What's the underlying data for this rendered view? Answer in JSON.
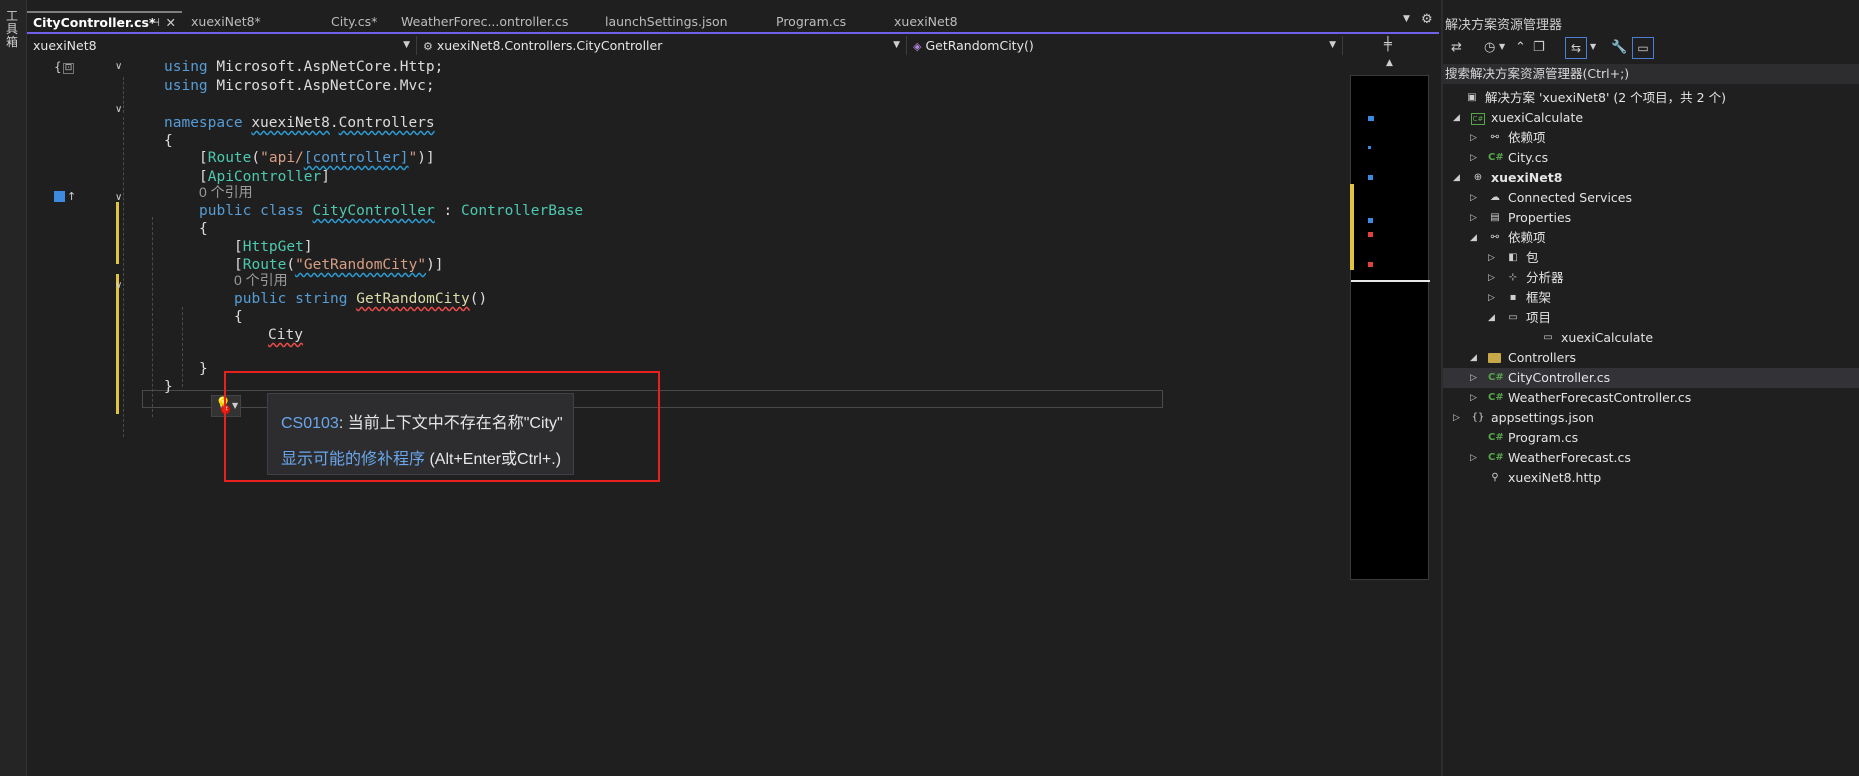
{
  "toolbox": {
    "label": "工具箱"
  },
  "tabs": [
    {
      "label": "CityController.cs*",
      "active": true
    },
    {
      "label": "xuexiNet8*"
    },
    {
      "label": "City.cs*"
    },
    {
      "label": "WeatherForec...ontroller.cs"
    },
    {
      "label": "launchSettings.json"
    },
    {
      "label": "Program.cs"
    },
    {
      "label": "xuexiNet8"
    }
  ],
  "tab_icons": {
    "pin": "pin-icon",
    "close": "close-icon",
    "overflow": "chevron-down-icon",
    "settings": "gear-icon"
  },
  "navbar": {
    "project": "xuexiNet8",
    "type": "xuexiNet8.Controllers.CityController",
    "member": "GetRandomCity()"
  },
  "code": {
    "l1a": "using",
    "l1b": " Microsoft.AspNetCore.Http;",
    "l2a": "using",
    "l2b": " Microsoft.AspNetCore.Mvc;",
    "l4a": "namespace",
    "l4b": "xuexiNet8",
    "l4c": ".",
    "l4d": "Controllers",
    "brace_open": "{",
    "brace_close": "}",
    "route1_open": "[",
    "route1_name": "Route",
    "route1_p": "(",
    "route1_str1": "\"api/",
    "route1_ctrl": "[controller]",
    "route1_str2": "\"",
    "route1_close": ")]",
    "apictrl_open": "[",
    "apictrl_name": "ApiController",
    "apictrl_close": "]",
    "refs1": "0 个引用",
    "class_kw1": "public",
    "class_kw2": "class",
    "class_name": "CityController",
    "class_colon": " : ",
    "class_base": "ControllerBase",
    "httpget_open": "[",
    "httpget_name": "HttpGet",
    "httpget_close": "]",
    "route2_open": "[",
    "route2_name": "Route",
    "route2_p": "(",
    "route2_str": "\"GetRandomCity\"",
    "route2_close": ")]",
    "refs2": "0 个引用",
    "m_kw1": "public",
    "m_kw2": "string",
    "m_name": "GetRandomCity",
    "m_parens": "()",
    "typed": "City"
  },
  "error_popup": {
    "code": "CS0103",
    "message": ": 当前上下文中不存在名称\"City\"",
    "fix_link": "显示可能的修补程序",
    "fix_shortcut": " (Alt+Enter或Ctrl+.)"
  },
  "solution_explorer": {
    "title": "解决方案资源管理器",
    "search_placeholder": "搜索解决方案资源管理器(Ctrl+;)",
    "nodes": [
      {
        "label": "解决方案 'xuexiNet8' (2 个项目，共 2 个)",
        "icon": "solution-icon"
      },
      {
        "label": "xuexiCalculate",
        "icon": "csproj-icon"
      },
      {
        "label": "依赖项",
        "icon": "dependencies-icon"
      },
      {
        "label": "City.cs",
        "icon": "csharp-file-icon"
      },
      {
        "label": "xuexiNet8",
        "icon": "web-project-icon",
        "bold": true
      },
      {
        "label": "Connected Services",
        "icon": "connected-services-icon"
      },
      {
        "label": "Properties",
        "icon": "properties-icon"
      },
      {
        "label": "依赖项",
        "icon": "dependencies-icon"
      },
      {
        "label": "包",
        "icon": "package-icon"
      },
      {
        "label": "分析器",
        "icon": "analyzer-icon"
      },
      {
        "label": "框架",
        "icon": "framework-icon"
      },
      {
        "label": "项目",
        "icon": "project-ref-icon"
      },
      {
        "label": "xuexiCalculate",
        "icon": "project-ref-item-icon"
      },
      {
        "label": "Controllers",
        "icon": "folder-icon"
      },
      {
        "label": "CityController.cs",
        "icon": "csharp-file-icon",
        "selected": true
      },
      {
        "label": "WeatherForecastController.cs",
        "icon": "csharp-file-icon"
      },
      {
        "label": "appsettings.json",
        "icon": "json-file-icon"
      },
      {
        "label": "Program.cs",
        "icon": "csharp-file-icon"
      },
      {
        "label": "WeatherForecast.cs",
        "icon": "csharp-file-icon"
      },
      {
        "label": "xuexiNet8.http",
        "icon": "http-file-icon"
      }
    ]
  },
  "colors": {
    "accent": "#7160e8",
    "error_border": "#e8201e",
    "link": "#69a7ea"
  }
}
